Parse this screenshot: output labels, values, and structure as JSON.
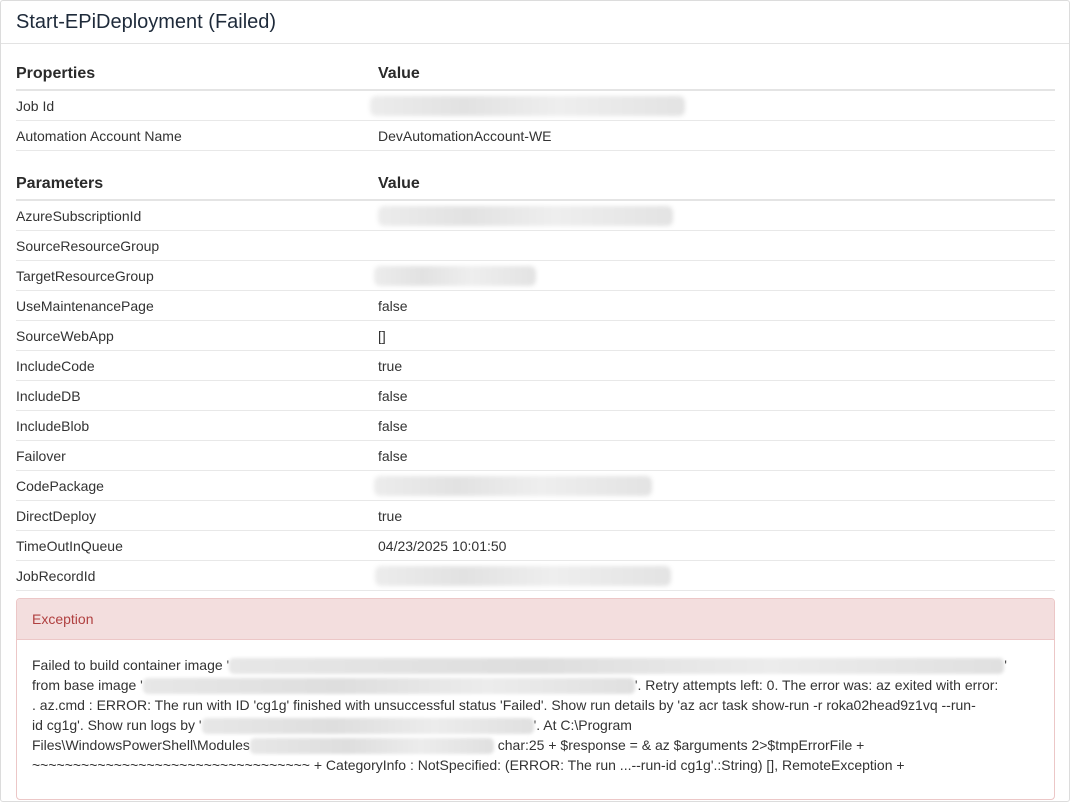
{
  "title": "Start-EPiDeployment (Failed)",
  "properties": {
    "header_name": "Properties",
    "header_value": "Value",
    "rows": [
      {
        "name": "Job Id",
        "value": ""
      },
      {
        "name": "Automation Account Name",
        "value": "DevAutomationAccount-WE"
      }
    ]
  },
  "parameters": {
    "header_name": "Parameters",
    "header_value": "Value",
    "rows": [
      {
        "name": "AzureSubscriptionId",
        "value": ""
      },
      {
        "name": "SourceResourceGroup",
        "value": ""
      },
      {
        "name": "TargetResourceGroup",
        "value": ""
      },
      {
        "name": "UseMaintenancePage",
        "value": "false"
      },
      {
        "name": "SourceWebApp",
        "value": "[]"
      },
      {
        "name": "IncludeCode",
        "value": "true"
      },
      {
        "name": "IncludeDB",
        "value": "false"
      },
      {
        "name": "IncludeBlob",
        "value": "false"
      },
      {
        "name": "Failover",
        "value": "false"
      },
      {
        "name": "CodePackage",
        "value": ""
      },
      {
        "name": "DirectDeploy",
        "value": "true"
      },
      {
        "name": "TimeOutInQueue",
        "value": "04/23/2025 10:01:50"
      },
      {
        "name": "JobRecordId",
        "value": ""
      }
    ]
  },
  "exception": {
    "title": "Exception",
    "line1_a": "Failed to build container image '",
    "line1_b": "'",
    "line2_a": "from base image '",
    "line2_b": "'. Retry attempts left: 0. The error was: az exited with error:",
    "line3": ". az.cmd : ERROR: The run with ID 'cg1g' finished with unsuccessful status 'Failed'. Show run details by 'az acr task show-run -r roka02head9z1vq --run-",
    "line4_a": "id cg1g'. Show run logs by '",
    "line4_b": "'. At C:\\Program",
    "line5_a": "Files\\WindowsPowerShell\\Modules",
    "line5_b": " char:25 + $response = & az $arguments 2>$tmpErrorFile +",
    "line6": "~~~~~~~~~~~~~~~~~~~~~~~~~~~~~~~~~~ + CategoryInfo : NotSpecified: (ERROR: The run ...--run-id cg1g'.:String) [], RemoteException +"
  }
}
